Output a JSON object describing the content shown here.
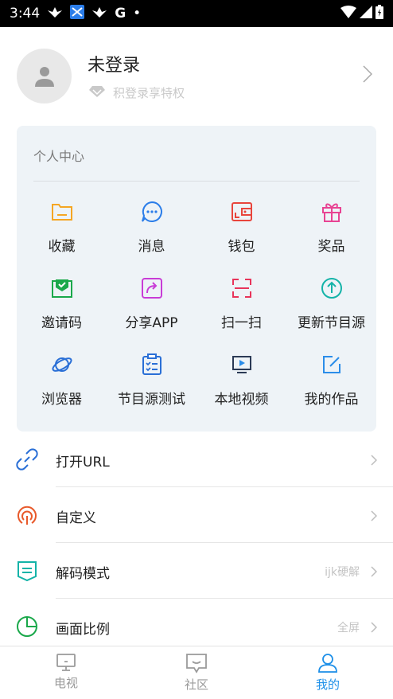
{
  "status_bar": {
    "time": "3:44",
    "notif_letter": "G",
    "dot": "•"
  },
  "profile": {
    "username": "未登录",
    "subtitle": "积登录享特权"
  },
  "personal_center": {
    "title": "个人中心",
    "items": [
      {
        "label": "收藏",
        "icon": "folder-icon",
        "color": "#f5a623"
      },
      {
        "label": "消息",
        "icon": "chat-bubble-icon",
        "color": "#2b7de9"
      },
      {
        "label": "钱包",
        "icon": "wallet-icon",
        "color": "#e8453c"
      },
      {
        "label": "奖品",
        "icon": "gift-icon",
        "color": "#e84393"
      },
      {
        "label": "邀请码",
        "icon": "invite-envelope-icon",
        "color": "#1aa84a"
      },
      {
        "label": "分享APP",
        "icon": "share-icon",
        "color": "#c83cd6"
      },
      {
        "label": "扫一扫",
        "icon": "scan-icon",
        "color": "#e8345a"
      },
      {
        "label": "更新节目源",
        "icon": "update-upload-icon",
        "color": "#14b3a8"
      },
      {
        "label": "浏览器",
        "icon": "planet-icon",
        "color": "#2a6fd6"
      },
      {
        "label": "节目源测试",
        "icon": "clipboard-checklist-icon",
        "color": "#2a6fd6"
      },
      {
        "label": "本地视频",
        "icon": "local-video-icon",
        "color": "#2b3a55"
      },
      {
        "label": "我的作品",
        "icon": "edit-icon",
        "color": "#2b8de9"
      }
    ]
  },
  "settings_list": [
    {
      "label": "打开URL",
      "value": "",
      "icon": "link-icon",
      "color": "#2a6fd6"
    },
    {
      "label": "自定义",
      "value": "",
      "icon": "custom-signal-icon",
      "color": "#e8592a"
    },
    {
      "label": "解码模式",
      "value": "ijk硬解",
      "icon": "decode-mode-icon",
      "color": "#14b3a8"
    },
    {
      "label": "画面比例",
      "value": "全屏",
      "icon": "pie-ratio-icon",
      "color": "#1aa84a"
    }
  ],
  "tabs": [
    {
      "label": "电视",
      "icon": "tv-icon",
      "active": false
    },
    {
      "label": "社区",
      "icon": "community-icon",
      "active": false
    },
    {
      "label": "我的",
      "icon": "user-icon",
      "active": true
    }
  ],
  "colors": {
    "accent": "#1d8fe8",
    "card_bg": "#eef3f7"
  }
}
